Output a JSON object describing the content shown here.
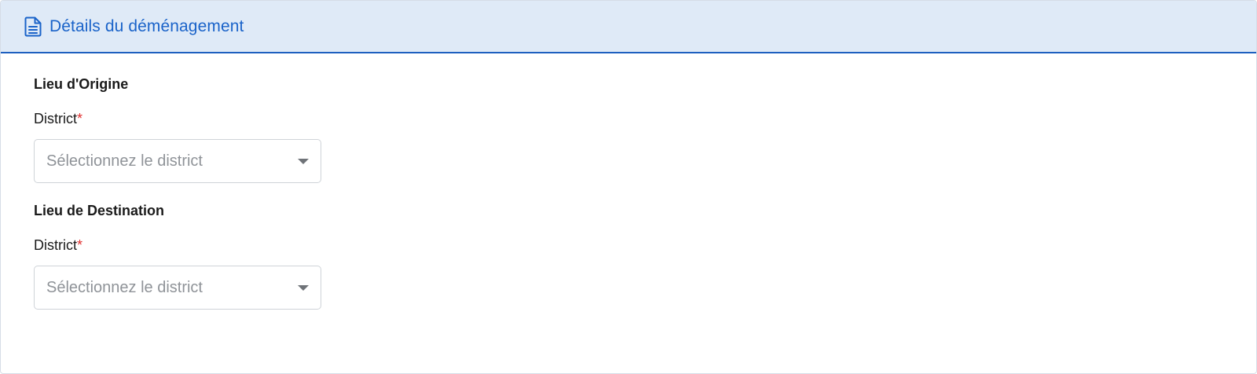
{
  "header": {
    "title": "Détails du déménagement",
    "icon": "document-icon",
    "accent_color": "#1a63c9",
    "background_color": "#dfeaf7"
  },
  "origin": {
    "section_title": "Lieu d'Origine",
    "district_label": "District",
    "required_mark": "*",
    "district_placeholder": "Sélectionnez le district"
  },
  "destination": {
    "section_title": "Lieu de Destination",
    "district_label": "District",
    "required_mark": "*",
    "district_placeholder": "Sélectionnez le district"
  }
}
